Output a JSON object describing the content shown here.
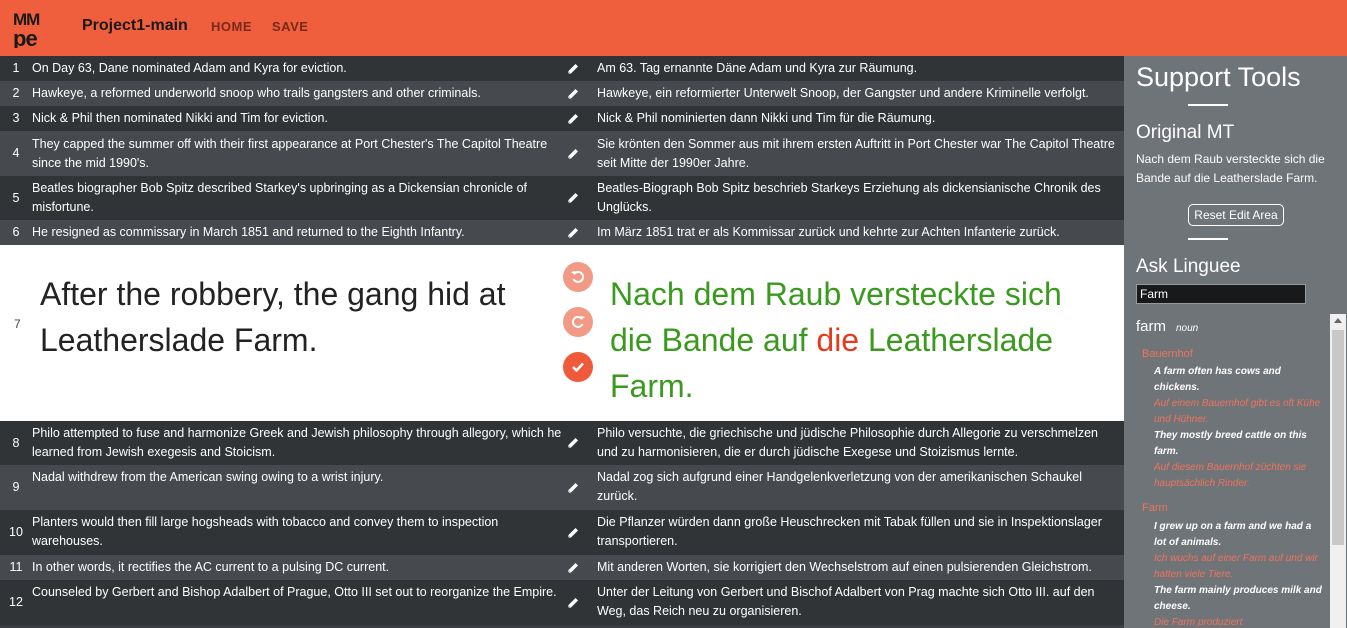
{
  "header": {
    "logo_text": "MMPE",
    "project": "Project1-main",
    "nav": {
      "home": "HOME",
      "save": "SAVE"
    }
  },
  "segments_before": [
    {
      "num": "1",
      "source": "On Day 63, Dane nominated Adam and Kyra for eviction.",
      "target": "Am 63. Tag ernannte Däne Adam und Kyra zur Räumung."
    },
    {
      "num": "2",
      "source": "Hawkeye, a reformed underworld snoop who trails gangsters and other criminals.",
      "target": "Hawkeye, ein reformierter Unterwelt Snoop, der Gangster und andere Kriminelle verfolgt."
    },
    {
      "num": "3",
      "source": "Nick & Phil then nominated Nikki and Tim for eviction.",
      "target": "Nick & Phil nominierten dann Nikki und Tim für die Räumung."
    },
    {
      "num": "4",
      "source": "They capped the summer off with their first appearance at Port Chester's The Capitol Theatre since the mid 1990's.",
      "target": "Sie krönten den Sommer aus mit ihrem ersten Auftritt in Port Chester war The Capitol Theatre seit Mitte der 1990er Jahre."
    },
    {
      "num": "5",
      "source": "Beatles biographer Bob Spitz described Starkey's upbringing as a Dickensian chronicle of misfortune.",
      "target": "Beatles-Biograph Bob Spitz beschrieb Starkeys Erziehung als dickensianische Chronik des Unglücks."
    },
    {
      "num": "6",
      "source": "He resigned as commissary in March 1851 and returned to the Eighth Infantry.",
      "target": "Im März 1851 trat er als Kommissar zurück und kehrte zur Achten Infanterie zurück."
    }
  ],
  "active_segment": {
    "num": "7",
    "source": "After the robbery, the gang hid at Leatherslade Farm.",
    "target_part1": "Nach dem Raub versteckte sich die Bande auf ",
    "target_error": "die",
    "target_part2": " Leatherslade Farm."
  },
  "segments_after": [
    {
      "num": "8",
      "source": "Philo attempted to fuse and harmonize Greek and Jewish philosophy through allegory, which he learned from Jewish exegesis and Stoicism.",
      "target": "Philo versuchte, die griechische und jüdische Philosophie durch Allegorie zu verschmelzen und zu harmonisieren, die er durch jüdische Exegese und Stoizismus lernte."
    },
    {
      "num": "9",
      "source": "Nadal withdrew from the American swing owing to a wrist injury.",
      "target": "Nadal zog sich aufgrund einer Handgelenkverletzung von der amerikanischen Schaukel zurück."
    },
    {
      "num": "10",
      "source": "Planters would then fill large hogsheads with tobacco and convey them to inspection warehouses.",
      "target": "Die Pflanzer würden dann große Heuschrecken mit Tabak füllen und sie in Inspektionslager transportieren."
    },
    {
      "num": "11",
      "source": "In other words, it rectifies the AC current to a pulsing DC current.",
      "target": "Mit anderen Worten, sie korrigiert den Wechselstrom auf einen pulsierenden Gleichstrom."
    },
    {
      "num": "12",
      "source": "Counseled by Gerbert and Bishop Adalbert of Prague, Otto III set out to reorganize the Empire.",
      "target": "Unter der Leitung von Gerbert und Bischof Adalbert von Prag machte sich Otto III. auf den Weg, das Reich neu zu organisieren."
    }
  ],
  "support": {
    "title": "Support Tools",
    "original_mt_title": "Original MT",
    "original_mt_text": "Nach dem Raub versteckte sich die Bande auf die Leatherslade Farm.",
    "reset_label": "Reset Edit Area",
    "linguee_title": "Ask Linguee",
    "search_value": "Farm",
    "term": "farm",
    "pos": "noun",
    "t1": "Bauernhof",
    "ex1_en": "A farm often has cows and chickens.",
    "ex1_de": "Auf einem Bauernhof gibt es oft Kühe und Hühner.",
    "ex2_en": "They mostly breed cattle on this farm.",
    "ex2_de": "Auf diesem Bauernhof züchten sie hauptsächlich Rinder.",
    "t2": "Farm",
    "ex3_en": "I grew up on a farm and we had a lot of animals.",
    "ex3_de": "Ich wuchs auf einer Farm auf und wir hatten viele Tiere.",
    "ex4_en": "The farm mainly produces milk and cheese.",
    "ex4_de": "Die Farm produziert"
  },
  "colors": {
    "header": "#ef5f3e",
    "row_dark": "#313437",
    "row_light": "#46494d",
    "panel": "#6f7479",
    "target_ok": "#3a9a1e",
    "target_error": "#e53a1e"
  }
}
